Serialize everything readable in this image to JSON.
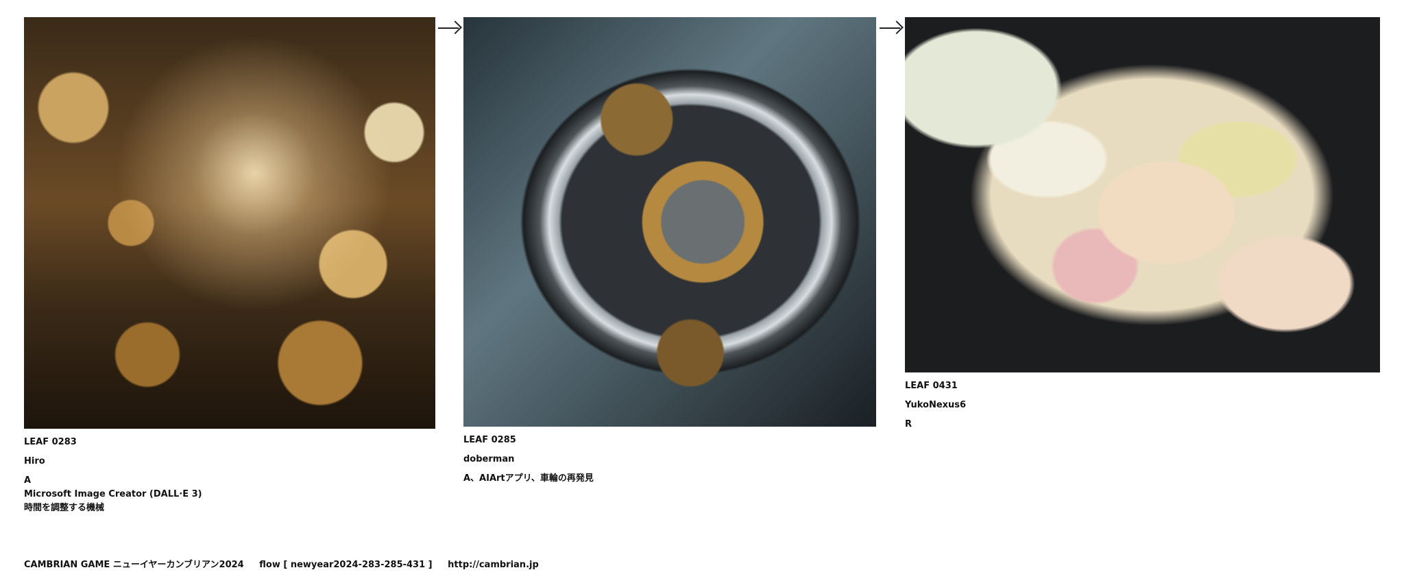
{
  "flow": {
    "arrow_icon": "arrow-right-icon",
    "leaves": [
      {
        "id": "LEAF 0283",
        "author": "Hiro",
        "type": "A",
        "tool": "Microsoft Image Creator (DALL·E 3)",
        "caption": "時間を調整する機械"
      },
      {
        "id": "LEAF 0285",
        "author": "doberman",
        "type": "A、AIArtアプリ、車輪の再発見"
      },
      {
        "id": "LEAF 0431",
        "author": "YukoNexus6",
        "type": "R"
      }
    ]
  },
  "footer": {
    "game_name": "CAMBRIAN GAME ニューイヤーカンブリアン2024",
    "flow_label": "flow [ newyear2024-283-285-431 ]",
    "url": "http://cambrian.jp"
  }
}
